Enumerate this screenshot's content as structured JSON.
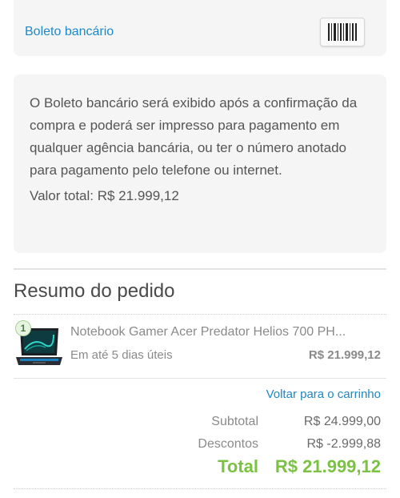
{
  "payment": {
    "method_label": "Boleto bancário",
    "barcode_icon": "barcode-icon",
    "info_text": "O Boleto bancário será exibido após a confirmação da compra e poderá ser impresso para pagamento em qualquer agência bancária, ou ter o número anotado para pagamento pelo telefone ou internet.",
    "total_text": "Valor total: R$ 21.999,12"
  },
  "summary": {
    "title": "Resumo do pedido",
    "item": {
      "quantity": "1",
      "name": "Notebook Gamer Acer Predator Helios 700 PH...",
      "delivery": "Em até 5 dias úteis",
      "price": "R$ 21.999,12"
    },
    "back_link": "Voltar para o carrinho",
    "subtotal_label": "Subtotal",
    "subtotal_value": "R$ 24.999,00",
    "discount_label": "Descontos",
    "discount_value": "R$ -2.999,88",
    "total_label": "Total",
    "total_value": "R$ 21.999,12"
  },
  "colors": {
    "link": "#1e88c7",
    "total": "#7cc242",
    "card_bg": "#f5f5f5"
  }
}
